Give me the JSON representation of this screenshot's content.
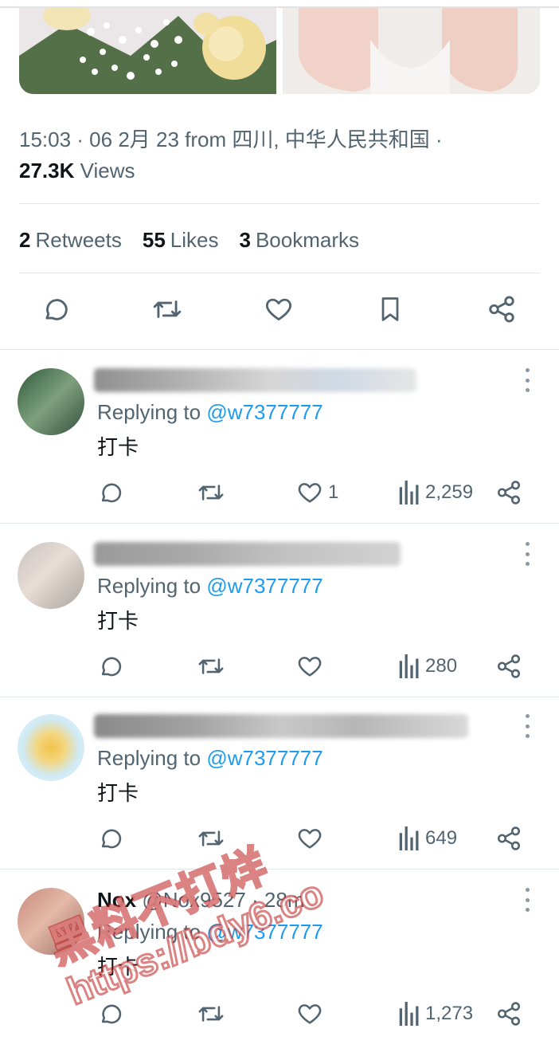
{
  "tweet": {
    "timestamp": "15:03 · 06 2月 23 from 四川, 中华人民共和国 ·",
    "views_count": "27.3K",
    "views_label": "Views",
    "retweets_count": "2",
    "retweets_label": "Retweets",
    "likes_count": "55",
    "likes_label": "Likes",
    "bookmarks_count": "3",
    "bookmarks_label": "Bookmarks"
  },
  "action_bar": {
    "icons": [
      "reply-icon",
      "retweet-icon",
      "like-icon",
      "bookmark-icon",
      "share-icon"
    ]
  },
  "replies": [
    {
      "replying_prefix": "Replying to",
      "handle": "@w7377777",
      "text": "打卡",
      "likes": "1",
      "views": "2,259"
    },
    {
      "replying_prefix": "Replying to",
      "handle": "@w7377777",
      "text": "打卡",
      "likes": "",
      "views": "280"
    },
    {
      "replying_prefix": "Replying to",
      "handle": "@w7377777",
      "text": "打卡",
      "likes": "",
      "views": "649"
    },
    {
      "name": "Nox",
      "user_meta": "@Nox9527 · 28m",
      "replying_prefix": "Replying to",
      "handle": "@w7377777",
      "text": "打卡",
      "likes": "",
      "views": "1,273"
    }
  ],
  "watermark": {
    "line1": "黑料不打烊",
    "line2": "https://bdy6.co"
  },
  "colors": {
    "text_primary": "#0f1419",
    "text_secondary": "#536471",
    "link": "#1d9bf0",
    "divider": "#e1e6ea"
  }
}
